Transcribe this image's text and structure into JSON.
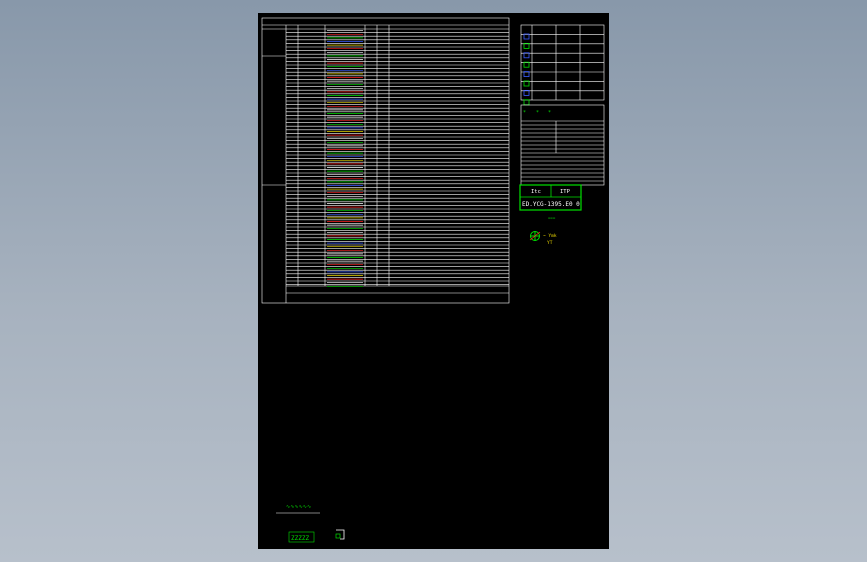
{
  "colors": {
    "viewport_background": "#8f9db0",
    "sheet_background": "#000000",
    "line": "#ffffff",
    "accent_green": "#00e000",
    "accent_blue": "#3a5cff",
    "accent_red": "#ff2020",
    "accent_yellow": "#e6d200"
  },
  "title_block": {
    "header_left": "Itc",
    "header_right": "ITP",
    "drawing_code": "ED.YCG-1395.E0 0",
    "dash_label": "===",
    "symbol_icon": "electrical-symbol-icon",
    "symbol_note_line1": "~ Ymk",
    "symbol_note_line2": "YT"
  },
  "legend_box": {
    "markers": [
      "*",
      "*",
      "*"
    ]
  },
  "bottom_notes": {
    "stamp_text": "∿∿∿∿∿∿",
    "bottom_code": "ZZZZZ",
    "corner_icon": "corner-marker-icon"
  }
}
